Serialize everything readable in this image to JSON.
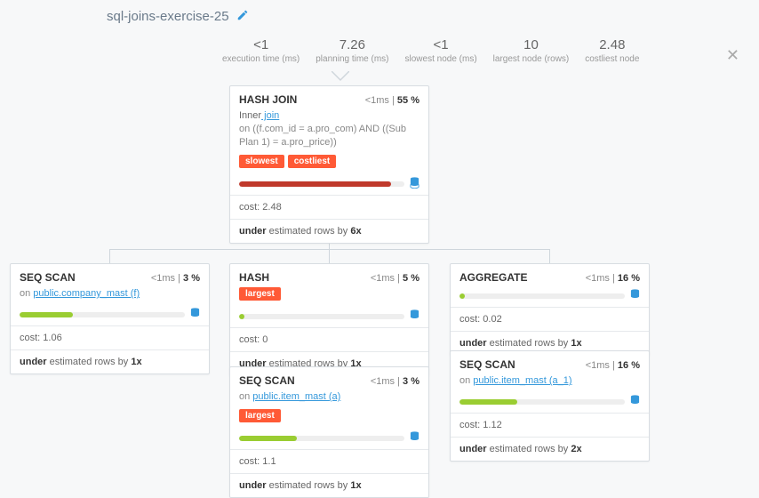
{
  "title": "sql-joins-exercise-25",
  "stats": {
    "exec_time": {
      "val": "<1",
      "label": "execution time (ms)"
    },
    "plan_time": {
      "val": "7.26",
      "label": "planning time (ms)"
    },
    "slowest": {
      "val": "<1",
      "label": "slowest node (ms)"
    },
    "largest": {
      "val": "10",
      "label": "largest node (rows)"
    },
    "costliest": {
      "val": "2.48",
      "label": "costliest node"
    }
  },
  "nodes": {
    "n1": {
      "title": "HASH JOIN",
      "time": "<1ms",
      "pct": "55 %",
      "join_type": "Inner",
      "on_clause": "on ((f.com_id = a.pro_com) AND ((Sub Plan 1) = a.pro_price))",
      "tags": [
        "slowest",
        "costliest"
      ],
      "bar_class": "bar-red",
      "bar_pct": 92,
      "cost": "cost: 2.48",
      "under_prefix": "under",
      "under_mid": " estimated rows by ",
      "under_factor": "6x"
    },
    "n2": {
      "title": "SEQ SCAN",
      "time": "<1ms",
      "pct": "3 %",
      "sub_prefix": "on ",
      "sub": "public.company_mast (f)",
      "bar_class": "bar-green",
      "bar_pct": 32,
      "cost": "cost: 1.06",
      "under_prefix": "under",
      "under_mid": " estimated rows by ",
      "under_factor": "1x"
    },
    "n3": {
      "title": "HASH",
      "time": "<1ms",
      "pct": "5 %",
      "tags": [
        "largest"
      ],
      "bar_class": "bar-green",
      "bar_pct": 3,
      "cost": "cost: 0",
      "under_prefix": "under",
      "under_mid": " estimated rows by ",
      "under_factor": "1x"
    },
    "n4": {
      "title": "AGGREGATE",
      "time": "<1ms",
      "pct": "16 %",
      "bar_class": "bar-green",
      "bar_pct": 3,
      "cost": "cost: 0.02",
      "under_prefix": "under",
      "under_mid": " estimated rows by ",
      "under_factor": "1x"
    },
    "n5": {
      "title": "SEQ SCAN",
      "time": "<1ms",
      "pct": "3 %",
      "sub_prefix": "on ",
      "sub": "public.item_mast (a)",
      "tags": [
        "largest"
      ],
      "bar_class": "bar-green",
      "bar_pct": 35,
      "cost": "cost: 1.1",
      "under_prefix": "under",
      "under_mid": " estimated rows by ",
      "under_factor": "1x"
    },
    "n6": {
      "title": "SEQ SCAN",
      "time": "<1ms",
      "pct": "16 %",
      "sub_prefix": "on ",
      "sub": "public.item_mast (a_1)",
      "bar_class": "bar-green",
      "bar_pct": 35,
      "cost": "cost: 1.12",
      "under_prefix": "under",
      "under_mid": " estimated rows by ",
      "under_factor": "2x"
    }
  },
  "labels": {
    "join_suffix": " join"
  }
}
